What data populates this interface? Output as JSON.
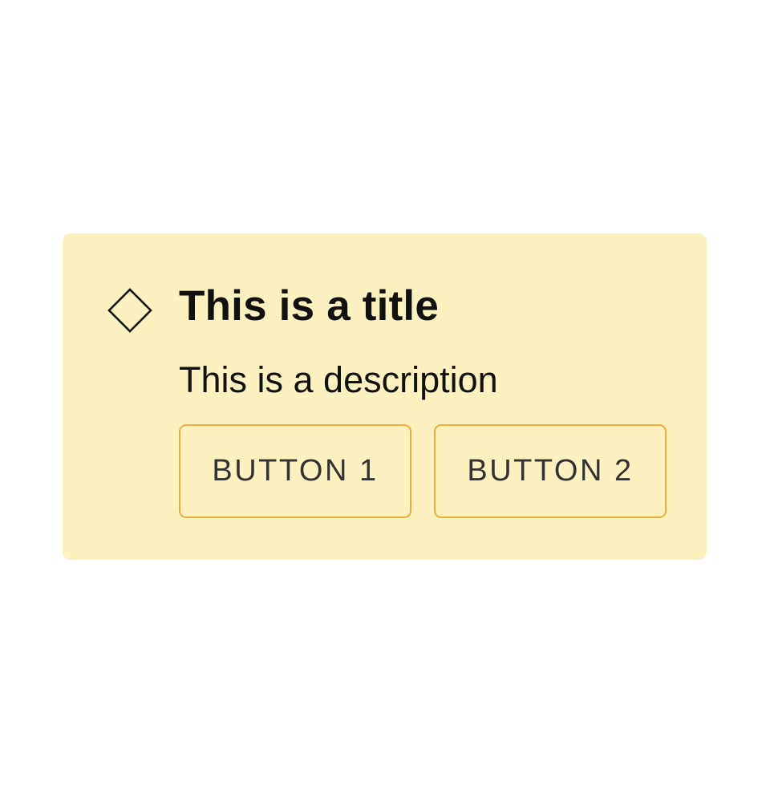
{
  "banner": {
    "icon": "diamond-outline-icon",
    "title": "This is a title",
    "description": "This is a description",
    "buttons": [
      {
        "label": "BUTTON 1"
      },
      {
        "label": "BUTTON 2"
      }
    ]
  },
  "colors": {
    "banner_background": "#fdf1bf",
    "button_border": "#f0ad3c",
    "text": "#111111",
    "button_text": "#333333"
  }
}
